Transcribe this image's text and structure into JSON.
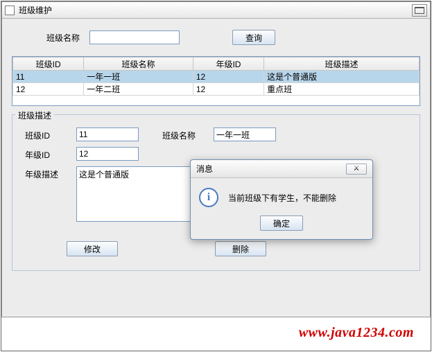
{
  "window": {
    "title": "班级维护"
  },
  "search": {
    "name_label": "班级名称",
    "name_value": "",
    "query_btn": "查询"
  },
  "table": {
    "headers": [
      "班级ID",
      "班级名称",
      "年级ID",
      "班级描述"
    ],
    "rows": [
      {
        "class_id": "11",
        "class_name": "一年一班",
        "grade_id": "12",
        "desc": "这是个普通版",
        "selected": true
      },
      {
        "class_id": "12",
        "class_name": "一年二班",
        "grade_id": "12",
        "desc": "重点班",
        "selected": false
      }
    ]
  },
  "detail": {
    "legend": "班级描述",
    "class_id_label": "班级ID",
    "class_id_value": "11",
    "class_name_label": "班级名称",
    "class_name_value": "一年一班",
    "grade_id_label": "年级ID",
    "grade_id_value": "12",
    "grade_desc_label": "年级描述",
    "grade_desc_value": "这是个普通版",
    "modify_btn": "修改",
    "delete_btn": "删除"
  },
  "dialog": {
    "title": "消息",
    "close_glyph": "⚔",
    "message": "当前班级下有学生，不能删除",
    "ok_btn": "确定"
  },
  "watermark": "www.java1234.com"
}
